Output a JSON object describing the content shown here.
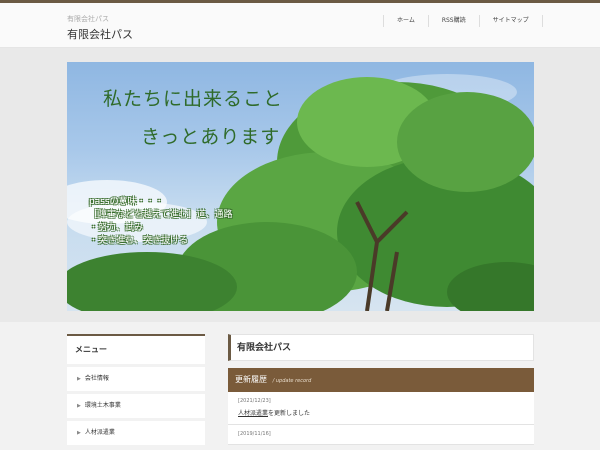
{
  "header": {
    "tagline": "有限会社パス",
    "title": "有限会社パス",
    "nav": [
      "ホーム",
      "RSS購読",
      "サイトマップ"
    ]
  },
  "hero": {
    "line1": "私たちに出来ること",
    "line2": "きっとあります",
    "meaning": [
      "passの意味・・・",
      "［障害などを越えて進む］道、通路",
      "・努力、試み",
      "・突き進む、突き抜ける"
    ]
  },
  "sidebar": {
    "heading": "メニュー",
    "items": [
      "会社情報",
      "環境土木事業",
      "人材派遣業"
    ]
  },
  "main": {
    "page_title": "有限会社パス",
    "updates_heading": "更新履歴",
    "updates_sub": "update record",
    "entries": [
      {
        "date": "[2021/12/23]",
        "link": "人材派遣業",
        "suffix": "を更新しました"
      },
      {
        "date": "[2019/11/16]",
        "link": "",
        "suffix": ""
      }
    ]
  },
  "colors": {
    "accent": "#6b5a44",
    "update_bar": "#7a5b3a",
    "hero_text": "#2f6b2a"
  }
}
